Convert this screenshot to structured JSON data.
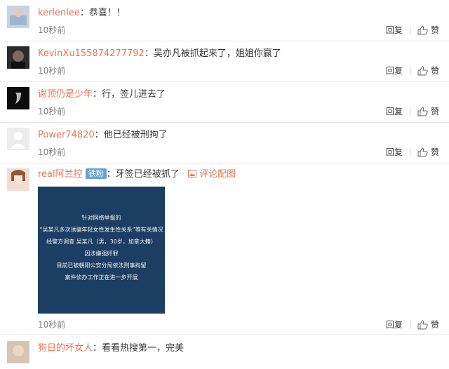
{
  "comments": [
    {
      "name": "kerlenlee",
      "separator": "：",
      "text": "恭喜！！",
      "time": "10秒前",
      "reply": "回复",
      "like": "赞"
    },
    {
      "name": "KevinXu155874277792",
      "separator": "：",
      "text": "吴亦凡被抓起来了，姐姐你赢了",
      "time": "10秒前",
      "reply": "回复",
      "like": "赞"
    },
    {
      "name": "谢顶仍是少年",
      "separator": "：",
      "text": "行，签儿进去了",
      "time": "10秒前",
      "reply": "回复",
      "like": "赞"
    },
    {
      "name": "Power74820",
      "separator": "：",
      "text": "他已经被刑拘了",
      "time": "10秒前",
      "reply": "回复",
      "like": "赞"
    },
    {
      "name": "real阿兰控",
      "badge": "铁粉",
      "separator": "：",
      "text": "牙签已经被抓了",
      "pic_link": "评论配图",
      "time": "10秒前",
      "reply": "回复",
      "like": "赞",
      "image_text": [
        "针对网络举报的",
        "“吴某凡多次诱骗年轻女性发生性关系”等有关情况",
        "经警方调查 吴某凡（男，30岁，加拿大籍）",
        "因涉嫌强奸罪",
        "目前已被朝阳公安分局依法刑事拘留",
        "案件侦办工作正在进一步开展"
      ]
    },
    {
      "name": "狗日的坏女人",
      "separator": "：",
      "text": "看看热搜第一，完美"
    }
  ]
}
